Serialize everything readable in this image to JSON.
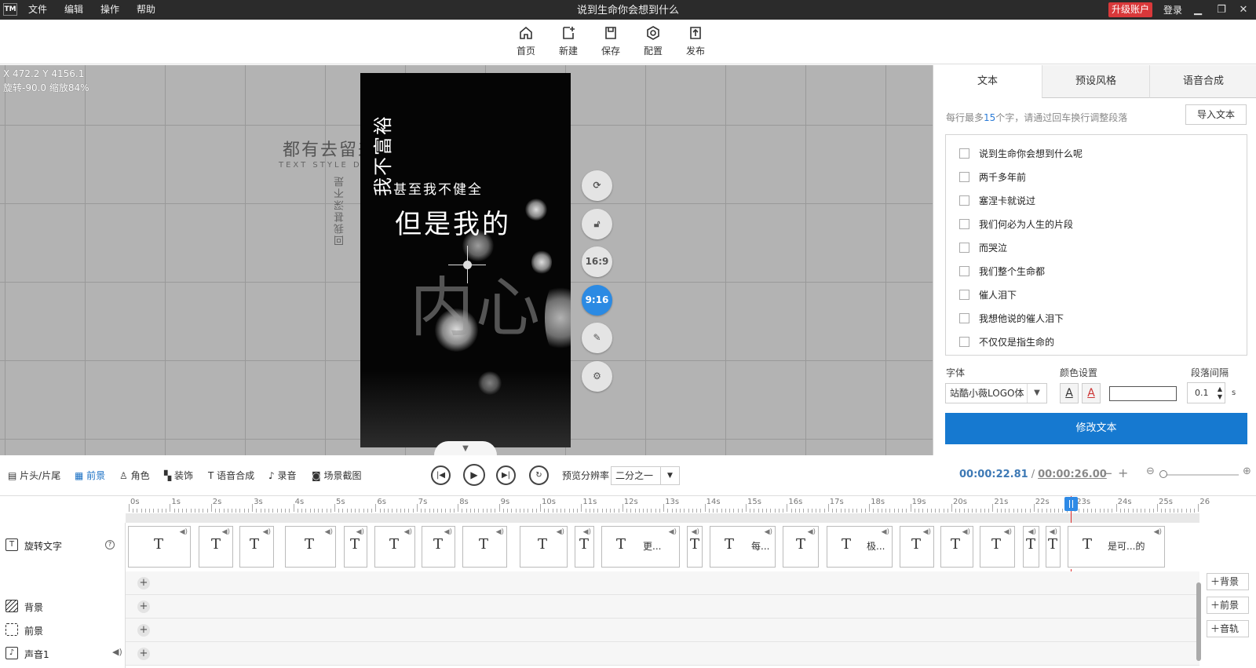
{
  "window": {
    "title": "说到生命你会想到什么",
    "logo": "TM",
    "upgrade": "升级账户",
    "login": "登录"
  },
  "menu": [
    "文件",
    "编辑",
    "操作",
    "帮助"
  ],
  "toolbar": {
    "home": "首页",
    "new": "新建",
    "save": "保存",
    "config": "配置",
    "publish": "发布"
  },
  "canvas": {
    "coords": "X 472.2 Y 4156.1",
    "transform": "旋转-90.0 缩放84%",
    "ghost_top": "都有去留来",
    "ghost_sub": "TEXT STYLE DEMO",
    "ghost_vert": "回我甚深不是"
  },
  "video": {
    "vertical_text": "我不富裕",
    "line1": "甚至我不健全",
    "line2": "但是我的",
    "big": "内心"
  },
  "ratio_buttons": {
    "r169": "16:9",
    "r916": "9:16"
  },
  "right_panel": {
    "tabs": [
      "文本",
      "预设风格",
      "语音合成"
    ],
    "hint_pre": "每行最多",
    "hint_num": "15",
    "hint_post": "个字，请通过回车换行调整段落",
    "import_label": "导入文本",
    "text_items": [
      "说到生命你会想到什么呢",
      "两千多年前",
      "塞涅卡就说过",
      "我们何必为人生的片段",
      "而哭泣",
      "我们整个生命都",
      "催人泪下",
      "我想他说的催人泪下",
      "不仅仅是指生命的"
    ],
    "font_label": "字体",
    "font_value": "站酷小薇LOGO体",
    "color_label": "颜色设置",
    "spacing_label": "段落间隔",
    "spacing_value": "0.1",
    "spacing_unit": "s",
    "modify_label": "修改文本"
  },
  "bottom_tabs": [
    "片头/片尾",
    "前景",
    "角色",
    "装饰",
    "语音合成",
    "录音",
    "场景截图"
  ],
  "playback": {
    "resolution_label": "预览分辨率",
    "resolution_value": "二分之一",
    "current_time": "00:00:22.81",
    "separator": "/",
    "total_time": "00:00:26.00",
    "zoom_minus": "−",
    "zoom_plus": "+"
  },
  "ruler": [
    "0s",
    "1s",
    "2s",
    "3s",
    "4s",
    "5s",
    "6s",
    "7s",
    "8s",
    "9s",
    "10s",
    "11s",
    "12s",
    "13s",
    "14s",
    "15s",
    "16s",
    "17s",
    "18s",
    "19s",
    "20s",
    "21s",
    "22s",
    "23s",
    "24s",
    "25s",
    "26"
  ],
  "tracks": {
    "rotate_text": "旋转文字",
    "bg_row": "背景",
    "fg_row": "前景",
    "sound_row": "声音1"
  },
  "clip_labels": {
    "c11": "更...",
    "c14": "每...",
    "c16": "极...",
    "c22": "是可...的"
  },
  "add_buttons": {
    "bg": "背景",
    "fg": "前景",
    "audio": "音轨"
  },
  "colors": {
    "accent": "#1679d0",
    "active_ratio": "#2b8ae3",
    "playhead": "#e02b2b",
    "time": "#3d79b5"
  }
}
